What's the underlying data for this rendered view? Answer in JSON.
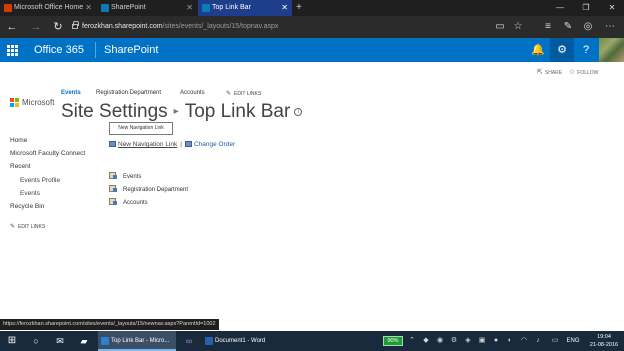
{
  "browser": {
    "tabs": [
      {
        "label": "Microsoft Office Home"
      },
      {
        "label": "SharePoint"
      },
      {
        "label": "Top Link Bar"
      }
    ],
    "url_host": "ferozkhan.sharepoint.com",
    "url_path": "/sites/events/_layouts/15/topnav.aspx",
    "status_url": "https://ferozkhan.sharepoint.com/sites/events/_layouts/15/newnav.aspx?ParentId=1002"
  },
  "suitebar": {
    "title": "Office 365",
    "app": "SharePoint"
  },
  "actions": {
    "share": "SHARE",
    "follow": "FOLLOW"
  },
  "topnav": {
    "items": [
      "Events",
      "Registration Department",
      "Accounts"
    ],
    "edit_links": "EDIT LINKS"
  },
  "logo": {
    "text": "Microsoft"
  },
  "page": {
    "crumb": "Site Settings",
    "title": "Top Link Bar",
    "tooltip": "New Navigation Link",
    "new_nav_link": "New Navigation Link",
    "change_order": "Change Order"
  },
  "leftnav": {
    "items": [
      "Home",
      "Microsoft Faculty Connect",
      "Recent",
      "Events Profile",
      "Events",
      "Recycle Bin"
    ],
    "edit_links": "EDIT LINKS"
  },
  "links": [
    "Events",
    "Registration Department",
    "Accounts"
  ],
  "taskbar": {
    "tasks": [
      "Top Link Bar - Micro...",
      "Document1 - Word"
    ],
    "battery": "90%",
    "lang": "ENG",
    "time": "19:04",
    "date": "21-08-2016"
  },
  "colors": {
    "suite_blue": "#0072c6",
    "active_tab": "#1e3e8c",
    "taskbar": "#1a2a3d"
  }
}
